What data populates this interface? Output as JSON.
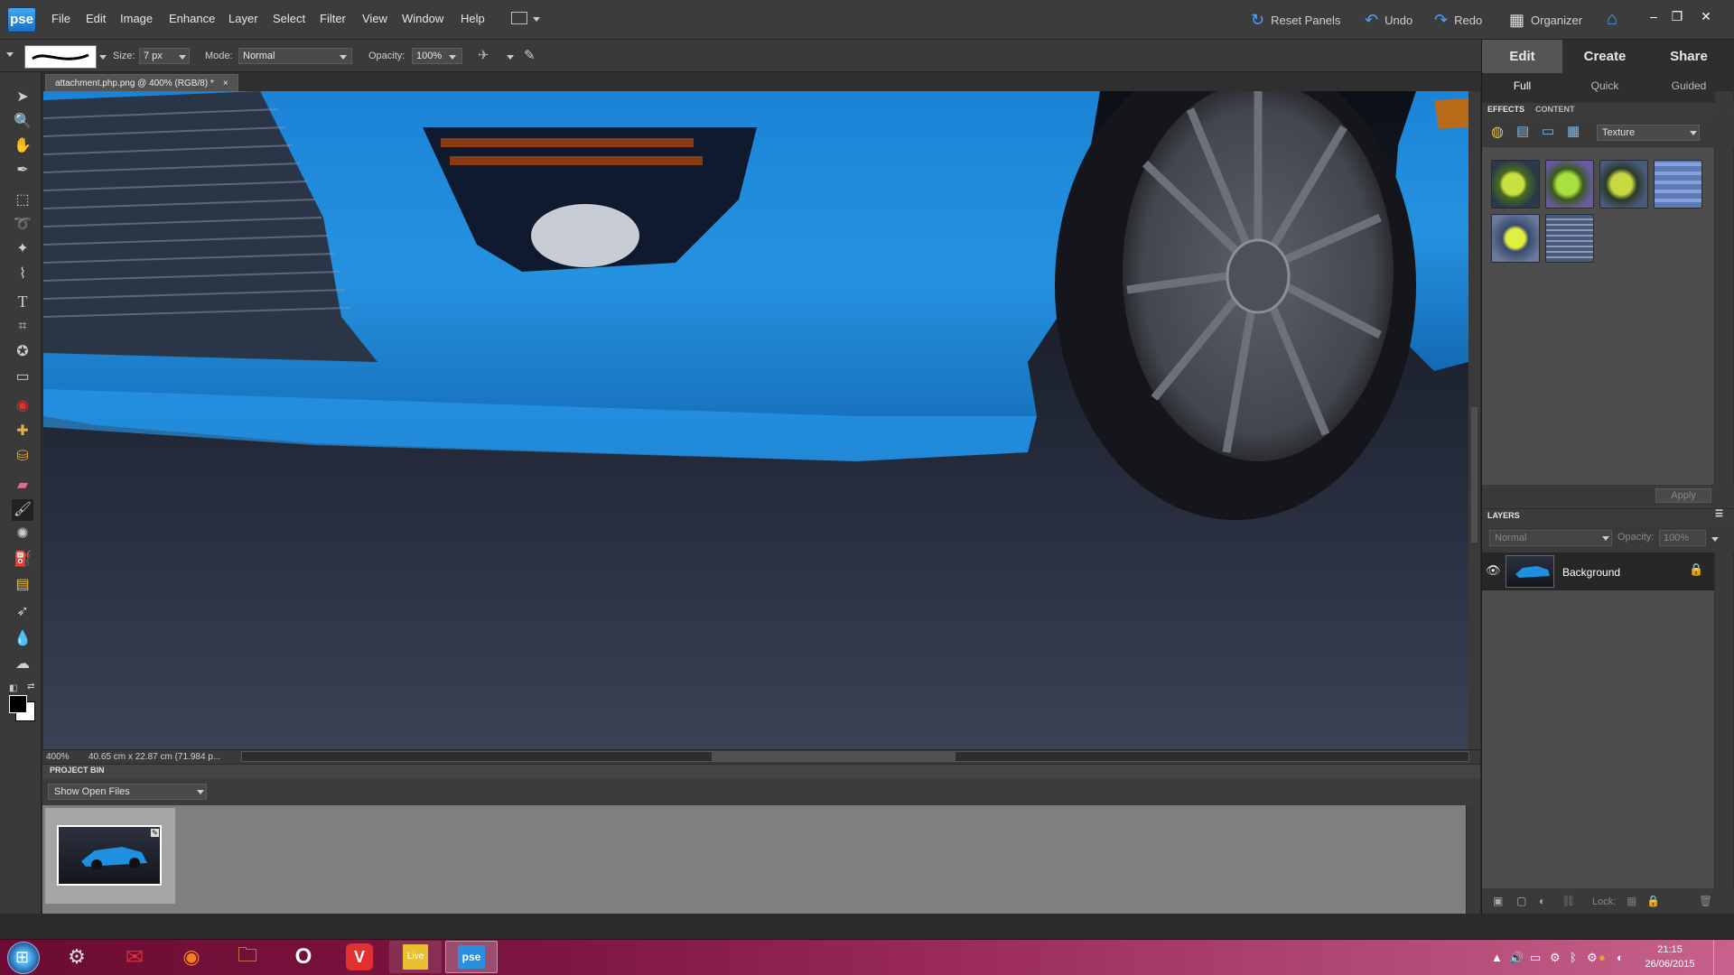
{
  "app": {
    "logo_text": "pse",
    "menu": [
      "File",
      "Edit",
      "Image",
      "Enhance",
      "Layer",
      "Select",
      "Filter",
      "View",
      "Window",
      "Help"
    ],
    "top_buttons": {
      "reset_panels": "Reset Panels",
      "undo": "Undo",
      "redo": "Redo",
      "organizer": "Organizer"
    }
  },
  "options_bar": {
    "size_label": "Size:",
    "size_value": "7 px",
    "mode_label": "Mode:",
    "mode_value": "Normal",
    "opacity_label": "Opacity:",
    "opacity_value": "100%"
  },
  "document": {
    "tab_title": "attachment.php.png @ 400% (RGB/8) *",
    "tab_close": "×",
    "zoom": "400%",
    "dimensions": "40.65 cm x 22.87 cm (71.984 p..."
  },
  "project_bin": {
    "title": "PROJECT BIN",
    "select_value": "Show Open Files"
  },
  "right_panel": {
    "tabs": [
      "Edit",
      "Create",
      "Share"
    ],
    "subtabs": [
      "Full",
      "Quick",
      "Guided"
    ],
    "effects_tab": "EFFECTS",
    "content_tab": "CONTENT",
    "effects_category": "Texture",
    "apply_label": "Apply",
    "layers_title": "LAYERS",
    "layers_mode": "Normal",
    "layers_opacity_label": "Opacity:",
    "layers_opacity_value": "100%",
    "layer_name": "Background",
    "lock_label": "Lock:"
  },
  "taskbar": {
    "time": "21:15",
    "date": "26/06/2015",
    "live_label": "Live",
    "pse_label": "pse"
  },
  "colors": {
    "accent": "#1e8ad8",
    "car_blue": "#1f8fe0",
    "panel_bg": "#4d4d4d"
  }
}
